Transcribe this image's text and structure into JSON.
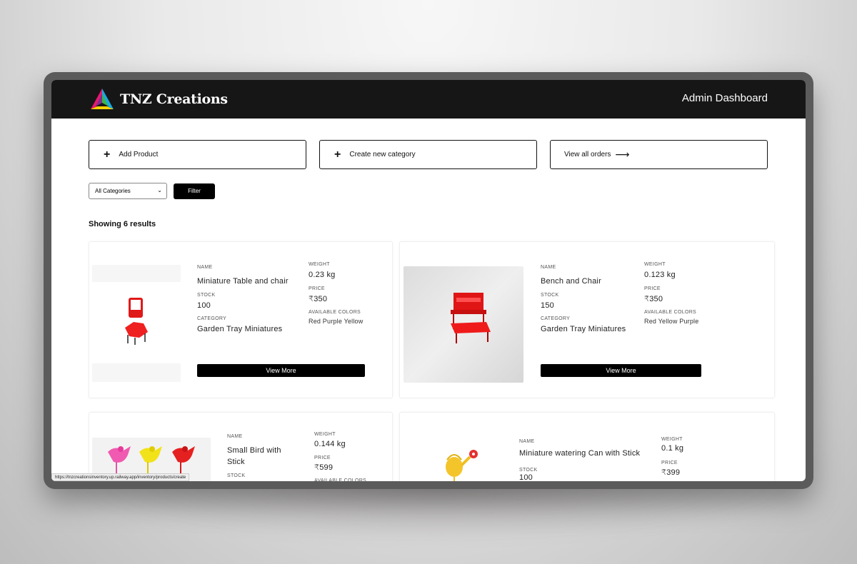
{
  "brand": {
    "name": "TNZ Creations"
  },
  "nav": {
    "title": "Admin Dashboard"
  },
  "actions": {
    "add_product": "Add Product",
    "create_category": "Create new category",
    "view_orders": "View all orders"
  },
  "filter": {
    "selected": "All Categories",
    "button": "Filter"
  },
  "results_text": "Showing 6 results",
  "labels": {
    "name": "NAME",
    "weight": "WEIGHT",
    "stock": "STOCK",
    "price": "PRICE",
    "category": "CATEGORY",
    "colors": "AVAILABLE COLORS",
    "view_more": "View More"
  },
  "products": [
    {
      "name": "Miniature Table and chair",
      "weight": "0.23 kg",
      "stock": "100",
      "price": "₹350",
      "category": "Garden Tray Miniatures",
      "colors": "Red Purple Yellow"
    },
    {
      "name": "Bench and Chair",
      "weight": "0.123 kg",
      "stock": "150",
      "price": "₹350",
      "category": "Garden Tray Miniatures",
      "colors": "Red Yellow Purple"
    },
    {
      "name": "Small Bird with Stick",
      "weight": "0.144 kg",
      "stock": "",
      "price": "₹599",
      "category": "",
      "colors": ""
    },
    {
      "name": "Miniature watering Can with Stick",
      "weight": "0.1 kg",
      "stock": "100",
      "price": "₹399",
      "category": "",
      "colors": ""
    }
  ],
  "status_url": "https://tnzcreationsinventory.up.railway.app/inventory/products/create"
}
